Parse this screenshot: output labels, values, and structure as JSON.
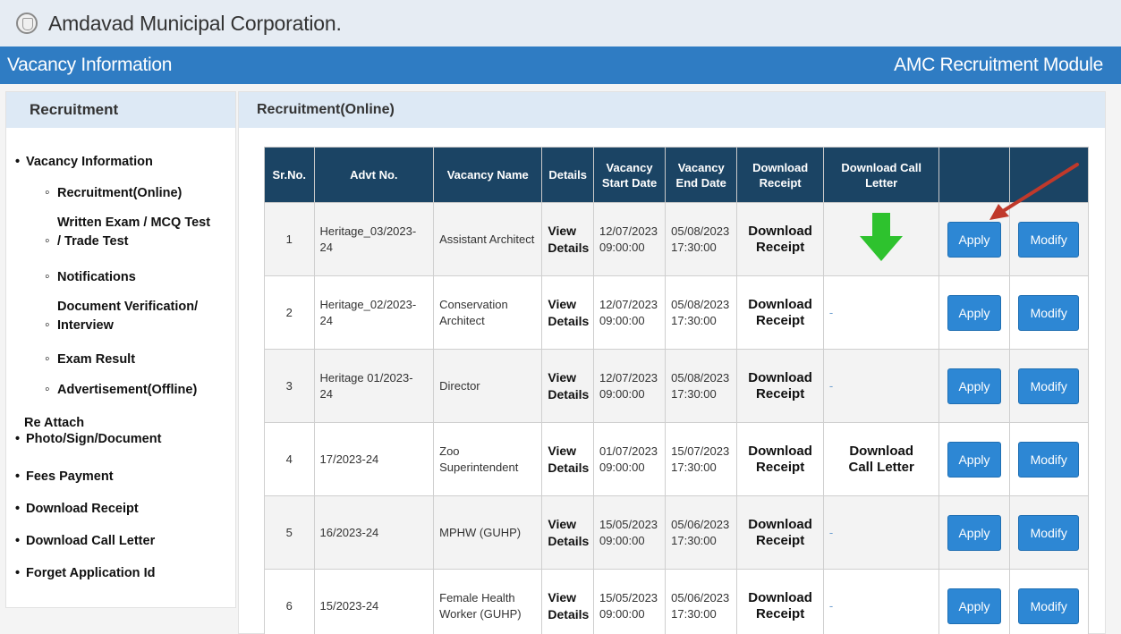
{
  "brand": {
    "name": "Amdavad Municipal Corporation."
  },
  "header": {
    "left_title": "Vacancy Information",
    "right_title": "AMC Recruitment Module"
  },
  "sidebar": {
    "title": "Recruitment",
    "items": [
      {
        "label": "Vacancy Information",
        "style": "bullet"
      },
      {
        "label": "Recruitment(Online)",
        "style": "circle"
      },
      {
        "label_line1": "Written Exam / MCQ Test",
        "label_line2": "/ Trade Test",
        "style": "circle"
      },
      {
        "label": "Notifications",
        "style": "circle"
      },
      {
        "label_line1": "Document Verification/",
        "label_line2": "Interview",
        "style": "circle"
      },
      {
        "label": "Exam Result",
        "style": "circle"
      },
      {
        "label": "Advertisement(Offline)",
        "style": "circle"
      },
      {
        "label_line1": "Re Attach",
        "label_line2": "Photo/Sign/Document",
        "style": "bullet"
      },
      {
        "label": "Fees Payment",
        "style": "bullet"
      },
      {
        "label": "Download Receipt",
        "style": "bullet"
      },
      {
        "label": "Download Call Letter",
        "style": "bullet"
      },
      {
        "label": "Forget Application Id",
        "style": "bullet"
      }
    ]
  },
  "main": {
    "title": "Recruitment(Online)",
    "columns": {
      "sr": "Sr.No.",
      "advt": "Advt No.",
      "name": "Vacancy Name",
      "details": "Details",
      "start_l1": "Vacancy",
      "start_l2": "Start Date",
      "end_l1": "Vacancy",
      "end_l2": "End Date",
      "receipt_l1": "Download",
      "receipt_l2": "Receipt",
      "call_l1": "Download Call",
      "call_l2": "Letter"
    },
    "labels": {
      "view": "View",
      "details": "Details",
      "download": "Download",
      "receipt": "Receipt",
      "call_letter": "Call Letter",
      "apply": "Apply",
      "modify": "Modify",
      "dash": "-"
    },
    "rows": [
      {
        "sr": "1",
        "advt_l1": "Heritage_03/2023-",
        "advt_l2": "24",
        "name_l1": "Assistant Architect",
        "name_l2": "",
        "start_date": "12/07/2023",
        "start_time": "09:00:00",
        "end_date": "05/08/2023",
        "end_time": "17:30:00",
        "call": "arrow"
      },
      {
        "sr": "2",
        "advt_l1": "Heritage_02/2023-",
        "advt_l2": "24",
        "name_l1": "Conservation",
        "name_l2": "Architect",
        "start_date": "12/07/2023",
        "start_time": "09:00:00",
        "end_date": "05/08/2023",
        "end_time": "17:30:00",
        "call": "dash"
      },
      {
        "sr": "3",
        "advt_l1": "Heritage 01/2023-",
        "advt_l2": "24",
        "name_l1": "Director",
        "name_l2": "",
        "start_date": "12/07/2023",
        "start_time": "09:00:00",
        "end_date": "05/08/2023",
        "end_time": "17:30:00",
        "call": "dash"
      },
      {
        "sr": "4",
        "advt_l1": "17/2023-24",
        "advt_l2": "",
        "name_l1": "Zoo Superintendent",
        "name_l2": "",
        "start_date": "01/07/2023",
        "start_time": "09:00:00",
        "end_date": "15/07/2023",
        "end_time": "17:30:00",
        "call": "link"
      },
      {
        "sr": "5",
        "advt_l1": "16/2023-24",
        "advt_l2": "",
        "name_l1": "MPHW (GUHP)",
        "name_l2": "",
        "start_date": "15/05/2023",
        "start_time": "09:00:00",
        "end_date": "05/06/2023",
        "end_time": "17:30:00",
        "call": "dash"
      },
      {
        "sr": "6",
        "advt_l1": "15/2023-24",
        "advt_l2": "",
        "name_l1": "Female Health",
        "name_l2": "Worker (GUHP)",
        "start_date": "15/05/2023",
        "start_time": "09:00:00",
        "end_date": "05/06/2023",
        "end_time": "17:30:00",
        "call": "dash"
      }
    ]
  },
  "colors": {
    "header_blue": "#2f7cc3",
    "table_head": "#1b4464",
    "button_blue": "#2d87d4",
    "arrow_green": "#2ec22e",
    "annotation_red": "#c0392b"
  }
}
